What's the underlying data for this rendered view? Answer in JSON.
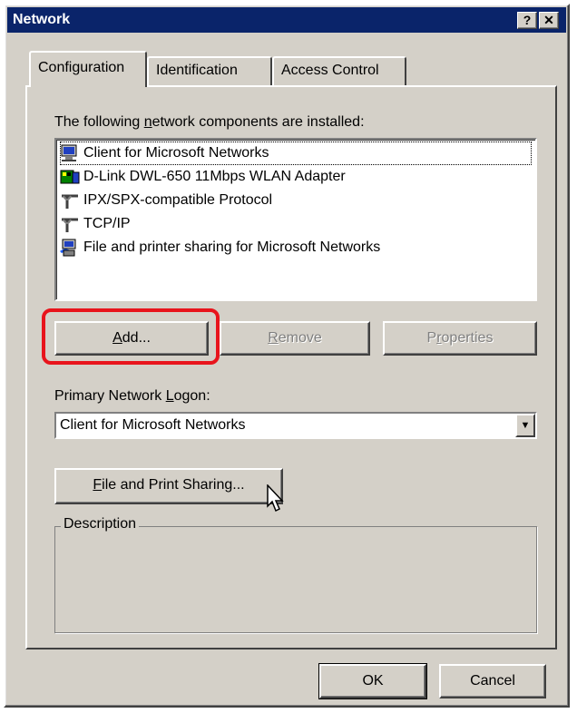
{
  "window": {
    "title": "Network",
    "help_label": "?",
    "close_label": "✕"
  },
  "tabs": [
    {
      "label": "Configuration",
      "active": true
    },
    {
      "label": "Identification",
      "active": false
    },
    {
      "label": "Access Control",
      "active": false
    }
  ],
  "components": {
    "label_pre": "The following ",
    "label_hotkey": "n",
    "label_post": "etwork components are installed:",
    "items": [
      {
        "label": "Client for Microsoft Networks",
        "icon": "client-network-icon"
      },
      {
        "label": "D-Link DWL-650 11Mbps WLAN Adapter",
        "icon": "network-adapter-icon"
      },
      {
        "label": "IPX/SPX-compatible Protocol",
        "icon": "protocol-icon"
      },
      {
        "label": "TCP/IP",
        "icon": "protocol-icon"
      },
      {
        "label": "File and printer sharing for Microsoft Networks",
        "icon": "file-printer-sharing-icon"
      }
    ]
  },
  "buttons": {
    "add_hotkey": "A",
    "add_rest": "dd...",
    "remove_hotkey": "R",
    "remove_rest": "emove",
    "properties_hotkey": "r",
    "properties_pre": "P",
    "properties_rest": "operties",
    "share_hotkey": "F",
    "share_rest": "ile and Print Sharing...",
    "ok_label": "OK",
    "cancel_label": "Cancel"
  },
  "logon": {
    "label_pre": "Primary Network ",
    "label_hotkey": "L",
    "label_post": "ogon:",
    "value": "Client for Microsoft Networks"
  },
  "description": {
    "title": "Description"
  },
  "colors": {
    "face": "#d4d0c8",
    "titlebar": "#0a246a",
    "highlight": "#e8141c"
  }
}
